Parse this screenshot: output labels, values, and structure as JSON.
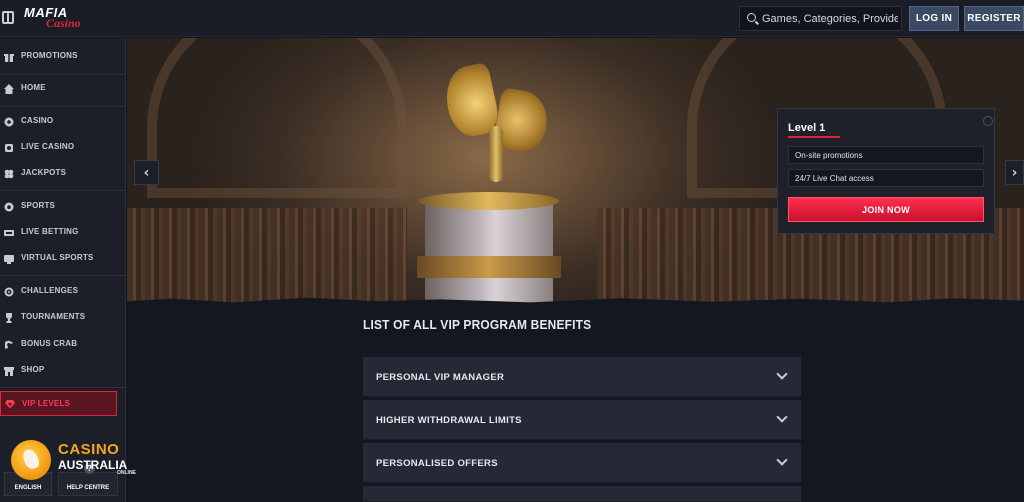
{
  "logo": {
    "word1": "MAFIA",
    "word2": "Casino"
  },
  "search": {
    "placeholder": "Games, Categories, Providers"
  },
  "header": {
    "login_label": "LOG IN",
    "register_label": "REGISTER"
  },
  "sidebar": {
    "items": [
      {
        "label": "PROMOTIONS",
        "icon": "gift-icon"
      },
      {
        "label": "HOME",
        "icon": "home-icon"
      },
      {
        "label": "CASINO",
        "icon": "slot-icon"
      },
      {
        "label": "LIVE CASINO",
        "icon": "live-icon"
      },
      {
        "label": "JACKPOTS",
        "icon": "clover-icon"
      },
      {
        "label": "SPORTS",
        "icon": "ball-icon"
      },
      {
        "label": "LIVE BETTING",
        "icon": "live-betting-icon"
      },
      {
        "label": "VIRTUAL SPORTS",
        "icon": "virtual-icon"
      },
      {
        "label": "CHALLENGES",
        "icon": "challenge-icon"
      },
      {
        "label": "TOURNAMENTS",
        "icon": "trophy-icon"
      },
      {
        "label": "BONUS CRAB",
        "icon": "crab-icon"
      },
      {
        "label": "SHOP",
        "icon": "shop-icon"
      },
      {
        "label": "VIP LEVELS",
        "icon": "diamond-icon"
      }
    ],
    "language_label": "ENGLISH",
    "help_label": "HELP CENTRE"
  },
  "badge": {
    "line1": "CASINO",
    "line2": "AUSTRALIA",
    "line3": "ONLINE"
  },
  "level_card": {
    "title": "Level 1",
    "benefits": [
      "On-site promotions",
      "24/7 Live Chat access"
    ],
    "join_label": "JOIN NOW"
  },
  "content": {
    "title": "LIST OF ALL VIP PROGRAM BENEFITS",
    "accordion": [
      "PERSONAL VIP MANAGER",
      "HIGHER WITHDRAWAL LIMITS",
      "PERSONALISED OFFERS"
    ]
  },
  "colors": {
    "accent": "#e0223d",
    "background": "#14171f",
    "panel": "#252935"
  }
}
